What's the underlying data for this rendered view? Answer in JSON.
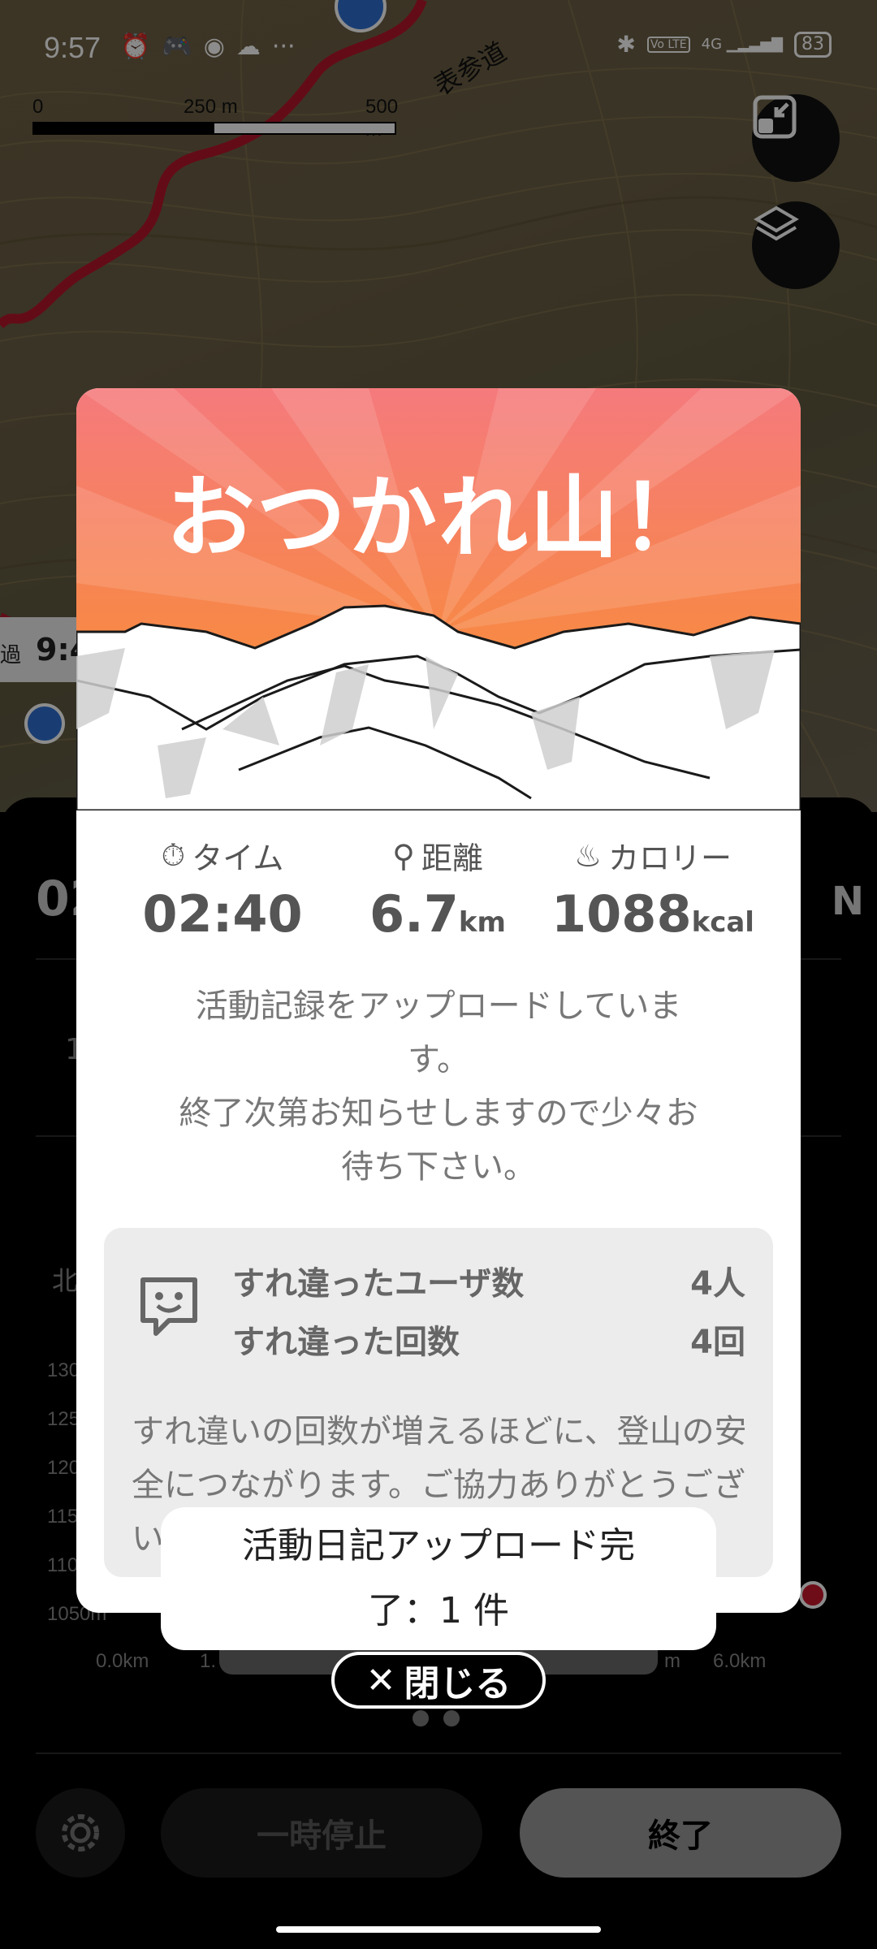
{
  "status_bar": {
    "time": "9:57",
    "left_icons": [
      "alarm-icon",
      "game-icon",
      "chrome-icon",
      "cloud-icon",
      "more-icon"
    ],
    "right_icons": [
      "bluetooth-icon",
      "volte-icon",
      "4g-signal-icon"
    ],
    "network": "4G",
    "volte": "Vo LTE",
    "battery": "83"
  },
  "map": {
    "scale": {
      "tick_0": "0",
      "tick_1": "250 m",
      "tick_2": "500 m"
    },
    "route_label": "表参道",
    "marker_time": "9:4",
    "marker_prefix": "過",
    "buttons": [
      "expand-icon",
      "layers-icon"
    ]
  },
  "sheet": {
    "elapsed_partial": "02",
    "compass_partial": "N",
    "elevation_ticks": [
      "130",
      "125",
      "120",
      "115",
      "110",
      "1050m"
    ],
    "distance_ticks": [
      "0.0km",
      "1.",
      "m",
      "6.0km"
    ],
    "partial_left_labels": [
      "北",
      "1"
    ],
    "pause_label": "一時停止",
    "end_label": "終了"
  },
  "modal": {
    "title": "おつかれ山！",
    "stats": [
      {
        "icon": "stopwatch-icon",
        "label": "タイム",
        "value": "02:40",
        "unit": ""
      },
      {
        "icon": "route-icon",
        "label": "距離",
        "value": "6.7",
        "unit": "km"
      },
      {
        "icon": "flame-icon",
        "label": "カロリー",
        "value": "1088",
        "unit": "kcal"
      }
    ],
    "message_line1": "活動記録をアップロードしていま",
    "message_line2": "す。",
    "message_line3": "終了次第お知らせしますので少々お",
    "message_line4": "待ち下さい。",
    "passing": {
      "users_label": "すれ違ったユーザ数",
      "users_value": "4人",
      "count_label": "すれ違った回数",
      "count_value": "4回",
      "note": "すれ違いの回数が増えるほどに、登山の安全につながります。ご協力ありがとうございます。"
    }
  },
  "toast": {
    "line1": "活動日記アップロード完",
    "line2": "了：1 件"
  },
  "close_button": {
    "label": "閉じる",
    "icon": "close-icon"
  },
  "pager": {
    "count": 2
  }
}
